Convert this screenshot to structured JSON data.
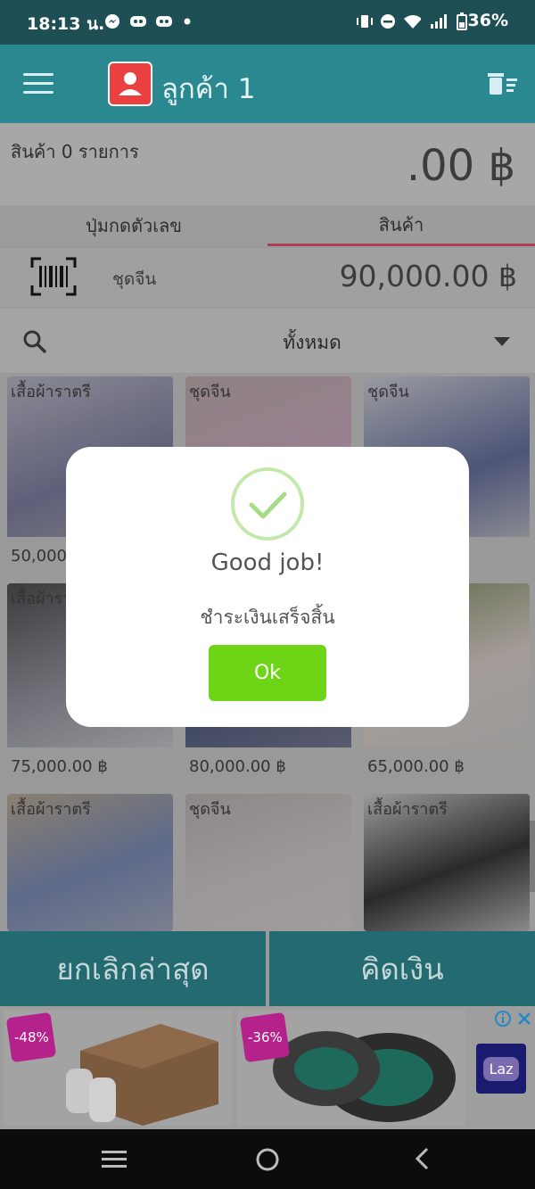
{
  "status_bar": {
    "time": "18:13 น.",
    "battery": "36%"
  },
  "app_bar": {
    "customer_name": "ลูกค้า 1"
  },
  "summary": {
    "item_count": "สินค้า 0 รายการ",
    "total": ".00 ฿"
  },
  "tabs": [
    {
      "label": "ปุ่มกดตัวเลข"
    },
    {
      "label": "สินค้า"
    }
  ],
  "selected_product": {
    "name": "ชุดจีน",
    "price": "90,000.00 ฿"
  },
  "filter": {
    "category": "ทั้งหมด"
  },
  "products": [
    {
      "category": "เสื้อผ้าราตรี",
      "price": "50,000.00 ฿"
    },
    {
      "category": "ชุดจีน",
      "price": ""
    },
    {
      "category": "ชุดจีน",
      "price": "฿"
    },
    {
      "category": "เสื้อผ้าราตรี",
      "price": "75,000.00 ฿"
    },
    {
      "category": "",
      "price": "80,000.00 ฿"
    },
    {
      "category": "",
      "price": "65,000.00 ฿"
    },
    {
      "category": "เสื้อผ้าราตรี",
      "price": ""
    },
    {
      "category": "ชุดจีน",
      "price": ""
    },
    {
      "category": "เสื้อผ้าราตรี",
      "price": ""
    }
  ],
  "bottom_buttons": {
    "cancel_last": "ยกเลิกล่าสุด",
    "checkout": "คิดเงิน"
  },
  "ad": {
    "badge1": "-48%",
    "badge2": "-36%",
    "brand": "Laz"
  },
  "dialog": {
    "title": "Good job!",
    "message": "ชำระเงินเสร็จสิ้น",
    "ok_label": "Ok"
  },
  "colors": {
    "teal": "#2a8891",
    "ok_green": "#6ed516",
    "check_green": "#a5dc86"
  }
}
